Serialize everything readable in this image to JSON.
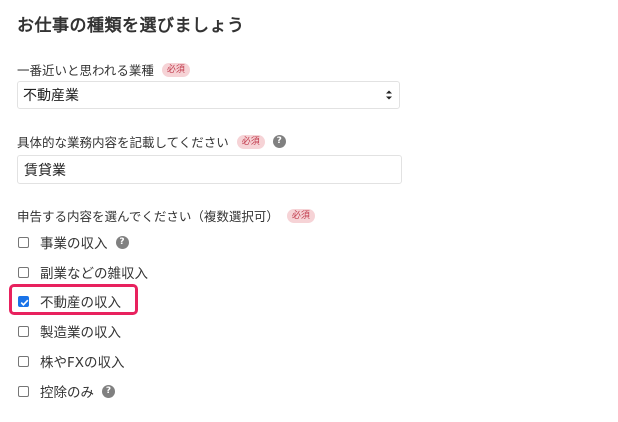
{
  "page": {
    "title": "お仕事の種類を選びましょう"
  },
  "industry": {
    "label": "一番近いと思われる業種",
    "required_badge": "必須",
    "selected_value": "不動産業"
  },
  "business_detail": {
    "label": "具体的な業務内容を記載してください",
    "required_badge": "必須",
    "help_icon": "question-circle-icon",
    "value": "賃貸業",
    "placeholder": ""
  },
  "declaration": {
    "label": "申告する内容を選んでください（複数選択可）",
    "required_badge": "必須",
    "options": [
      {
        "label": "事業の収入",
        "checked": false,
        "help": true
      },
      {
        "label": "副業などの雑収入",
        "checked": false,
        "help": false
      },
      {
        "label": "不動産の収入",
        "checked": true,
        "help": false
      },
      {
        "label": "製造業の収入",
        "checked": false,
        "help": false
      },
      {
        "label": "株やFXの収入",
        "checked": false,
        "help": false
      },
      {
        "label": "控除のみ",
        "checked": false,
        "help": true
      }
    ]
  },
  "colors": {
    "badge_bg": "#f6d3d6",
    "badge_text": "#c0394b",
    "checkbox_checked": "#1a73e8",
    "highlight": "#e8215e",
    "help_icon": "#808080"
  }
}
